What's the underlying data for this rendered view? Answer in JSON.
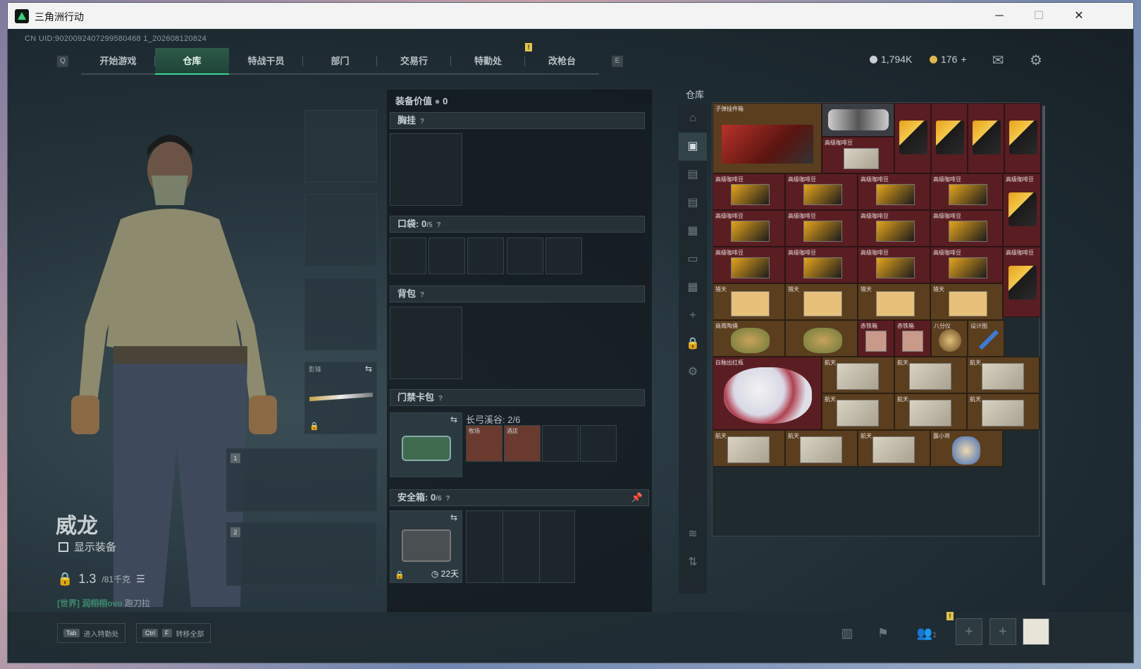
{
  "window": {
    "title": "三角洲行动",
    "min": "─",
    "max": "☐",
    "close": "✕"
  },
  "uid": "CN UID:9020092407299580468 1_202608120824",
  "nav": {
    "left_key": "Q",
    "right_key": "E",
    "tabs": [
      "开始游戏",
      "仓库",
      "特战干员",
      "部门",
      "交易行",
      "特勤处",
      "改枪台"
    ],
    "alert": "!"
  },
  "currency": {
    "silver": "1,794K",
    "gold": "176",
    "plus": "+"
  },
  "character": {
    "name": "威龙",
    "show_equip": "显示装备",
    "weight": "1.3",
    "weight_unit": "/81千克",
    "chat_prefix": "[世界] 润栩栩ovo",
    "chat_text": "跑刀拉"
  },
  "slots": {
    "melee_label": "影锋",
    "weapon1": "1",
    "weapon2": "2"
  },
  "mid": {
    "equip_value_label": "装备价值",
    "equip_value": "0",
    "chest": "胸挂",
    "pocket": "口袋:",
    "pocket_count": "0",
    "pocket_cap": "/5",
    "backpack": "背包",
    "keycard": "门禁卡包",
    "keycard_area": "长弓溪谷: 2/6",
    "card1": "牧场",
    "card2": "酒店",
    "safe": "安全箱:",
    "safe_count": "0",
    "safe_cap": "/6",
    "safe_days": "22天",
    "q": "?"
  },
  "warehouse": {
    "title": "仓库",
    "items": {
      "tea": "子弹挂件箱",
      "coffee": "高级咖啡豆",
      "pass": "航天",
      "vase": "白釉出红瓶",
      "paper": "猎天",
      "statue": "商周陶俑",
      "box": "赤铁箱",
      "compass": "八分仪",
      "design": "设计图",
      "doll": "露小将"
    }
  },
  "bottom": {
    "tab_key": "Tab",
    "tab_label": "进入特勤处",
    "ctrl_key": "Ctrl",
    "f_key": "F",
    "ctrl_label": "转移全部",
    "friends": "1",
    "alert": "!"
  }
}
